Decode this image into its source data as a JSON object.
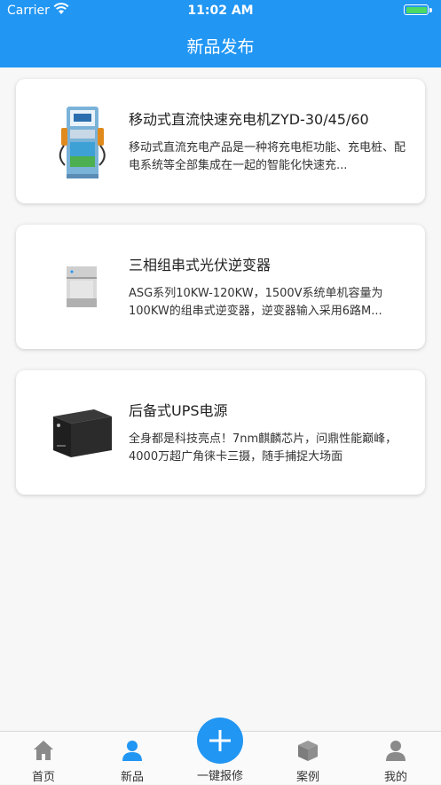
{
  "status_bar": {
    "carrier": "Carrier",
    "time": "11:02 AM"
  },
  "nav": {
    "title": "新品发布"
  },
  "products": [
    {
      "title": "移动式直流快速充电机ZYD-30/45/60",
      "desc": "移动式直流充电产品是一种将充电柜功能、充电桩、配电系统等全部集成在一起的智能化快速充..."
    },
    {
      "title": "三相组串式光伏逆变器",
      "desc": "ASG系列10KW-120KW，1500V系统单机容量为100KW的组串式逆变器，逆变器输入采用6路M..."
    },
    {
      "title": "后备式UPS电源",
      "desc": "全身都是科技亮点！7nm麒麟芯片，问鼎性能巅峰，4000万超广角徕卡三摄，随手捕捉大场面"
    }
  ],
  "tabs": [
    {
      "label": "首页",
      "icon": "home-icon"
    },
    {
      "label": "新品",
      "icon": "person-icon"
    },
    {
      "label": "一键报修",
      "icon": "plus-icon"
    },
    {
      "label": "案例",
      "icon": "box-icon"
    },
    {
      "label": "我的",
      "icon": "user-icon"
    }
  ],
  "colors": {
    "primary": "#2196f3",
    "battery": "#4cd964"
  }
}
